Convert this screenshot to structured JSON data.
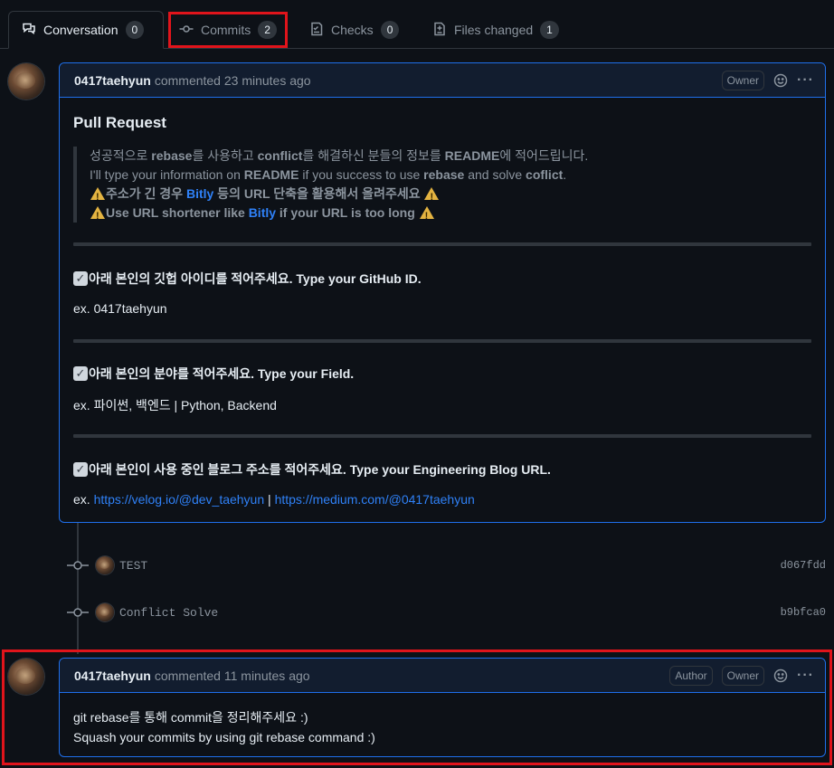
{
  "tabs": [
    {
      "label": "Conversation",
      "count": "0",
      "icon": "comment-discussion-icon"
    },
    {
      "label": "Commits",
      "count": "2",
      "icon": "git-commit-icon"
    },
    {
      "label": "Checks",
      "count": "0",
      "icon": "checklist-icon"
    },
    {
      "label": "Files changed",
      "count": "1",
      "icon": "file-diff-icon"
    }
  ],
  "comment1": {
    "author": "0417taehyun",
    "meta": "commented 23 minutes ago",
    "badge": "Owner",
    "title": "Pull Request",
    "quote": {
      "line1_a": "성공적으로 ",
      "line1_b": "rebase",
      "line1_c": "를 사용하고 ",
      "line1_d": "conflict",
      "line1_e": "를 해결하신 분들의 정보를 ",
      "line1_f": "README",
      "line1_g": "에 적어드립니다.",
      "line2_a": "I'll type your information on ",
      "line2_b": "README",
      "line2_c": " if you success to use ",
      "line2_d": "rebase",
      "line2_e": " and solve ",
      "line2_f": "coflict",
      "line2_g": ".",
      "line3_a": "주소가 긴 경우 ",
      "line3_link": "Bitly",
      "line3_b": " 등의 URL 단축을 활용해서 올려주세요 ",
      "line4_a": "Use URL shortener like ",
      "line4_link": "Bitly",
      "line4_b": " if your URL is too long "
    },
    "section1_title": "아래 본인의 깃헙 아이디를 적어주세요. Type your GitHub ID.",
    "section1_text": "ex. 0417taehyun",
    "section2_title": "아래 본인의 분야를 적어주세요. Type your Field.",
    "section2_text": "ex. 파이썬, 백엔드 | Python, Backend",
    "section3_title": "아래 본인이 사용 중인 블로그 주소를 적어주세요. Type your Engineering Blog URL.",
    "section3_prefix": "ex. ",
    "section3_link1": "https://velog.io/@dev_taehyun",
    "section3_sep": " | ",
    "section3_link2": "https://medium.com/@0417taehyun"
  },
  "commits": [
    {
      "message": "TEST",
      "sha": "d067fdd"
    },
    {
      "message": "Conflict Solve",
      "sha": "b9bfca0"
    }
  ],
  "comment2": {
    "author": "0417taehyun",
    "meta": "commented 11 minutes ago",
    "badge_author": "Author",
    "badge_owner": "Owner",
    "line1": "git rebase를 통해 commit을 정리해주세요 :)",
    "line2": "Squash your commits by using git rebase command :)"
  },
  "colors": {
    "background": "#0d1117",
    "accent": "#1f6feb",
    "link": "#2f81f7",
    "highlight_box": "#e0141b"
  }
}
